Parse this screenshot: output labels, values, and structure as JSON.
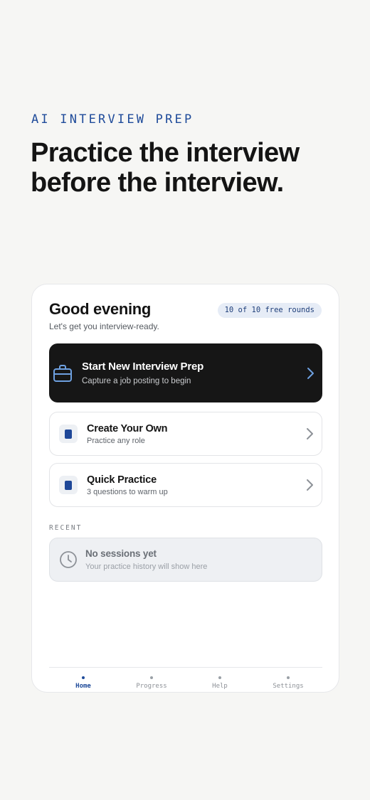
{
  "hero": {
    "eyebrow": "AI INTERVIEW PREP",
    "headline": "Practice the interview before the interview."
  },
  "card": {
    "greeting": "Good evening",
    "subgreeting": "Let's get you interview-ready.",
    "badge": "10 of 10 free rounds",
    "primary_action": {
      "title": "Start New Interview Prep",
      "subtitle": "Capture a job posting to begin",
      "icon": "briefcase-icon"
    },
    "actions": [
      {
        "title": "Create Your Own",
        "subtitle": "Practice any role",
        "icon": "square-icon"
      },
      {
        "title": "Quick Practice",
        "subtitle": "3 questions to warm up",
        "icon": "square-icon"
      }
    ],
    "recent": {
      "label": "RECENT",
      "empty_title": "No sessions yet",
      "empty_subtitle": "Your practice history will show here",
      "icon": "clock-icon"
    },
    "tabs": [
      {
        "label": "Home",
        "active": true
      },
      {
        "label": "Progress",
        "active": false
      },
      {
        "label": "Help",
        "active": false
      },
      {
        "label": "Settings",
        "active": false
      }
    ]
  },
  "colors": {
    "accent": "#1f4b9a",
    "background": "#f6f6f4",
    "primary_tile": "#161616",
    "badge_bg": "#e6ecf6"
  }
}
